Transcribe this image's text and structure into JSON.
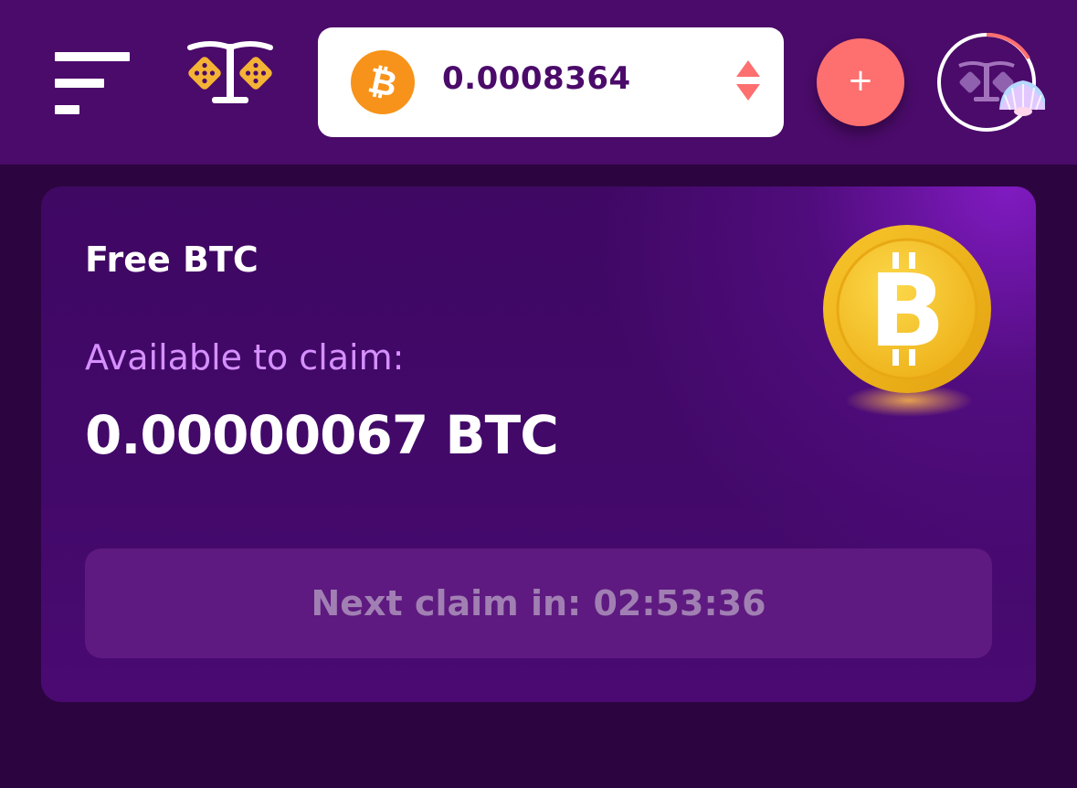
{
  "header": {
    "balance": {
      "currency_icon": "bitcoin-icon",
      "amount": "0.0008364"
    },
    "deposit_label": "+"
  },
  "faucet": {
    "title": "Free BTC",
    "available_label": "Available to claim:",
    "available_amount": "0.00000067 BTC",
    "next_claim_text": "Next claim in: 02:53:36"
  },
  "colors": {
    "header_bg": "#4b0b6a",
    "page_bg": "#2c0540",
    "accent_coral": "#fe6f6f",
    "btc_orange": "#f7931a",
    "label_lilac": "#d690ff"
  }
}
